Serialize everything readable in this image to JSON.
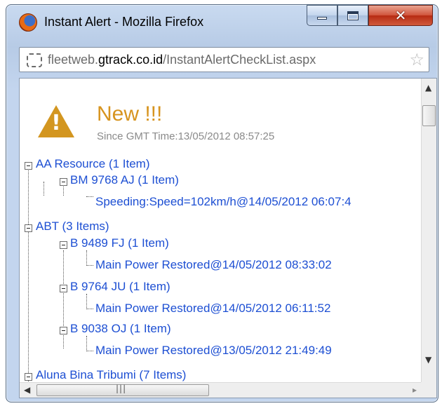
{
  "window": {
    "title": "Instant Alert - Mozilla Firefox",
    "url_prefix": "fleetweb.",
    "url_domain": "gtrack.co.id",
    "url_path": "/InstantAlertCheckList.aspx"
  },
  "alert": {
    "heading": "New !!!",
    "since": "Since GMT Time:13/05/2012 08:57:25"
  },
  "tree": [
    {
      "label": "AA Resource (1 Item)"
    },
    {
      "label": "BM 9768 AJ (1 Item)"
    },
    {
      "label": "Speeding:Speed=102km/h@14/05/2012 06:07:4"
    },
    {
      "label": "ABT (3 Items)"
    },
    {
      "label": "B 9489 FJ (1 Item)"
    },
    {
      "label": "Main Power Restored@14/05/2012 08:33:02"
    },
    {
      "label": "B 9764 JU (1 Item)"
    },
    {
      "label": "Main Power Restored@14/05/2012 06:11:52"
    },
    {
      "label": "B 9038 OJ (1 Item)"
    },
    {
      "label": "Main Power Restored@13/05/2012 21:49:49"
    },
    {
      "label": "Aluna Bina Tribumi (7 Items)"
    }
  ],
  "icons": {
    "app": "firefox-icon",
    "site": "site-identity-icon",
    "bookmark": "star-icon",
    "alert": "warning-icon"
  },
  "colors": {
    "link": "#1d4fd3",
    "heading": "#d7941f",
    "close_button": "#c8442a"
  }
}
